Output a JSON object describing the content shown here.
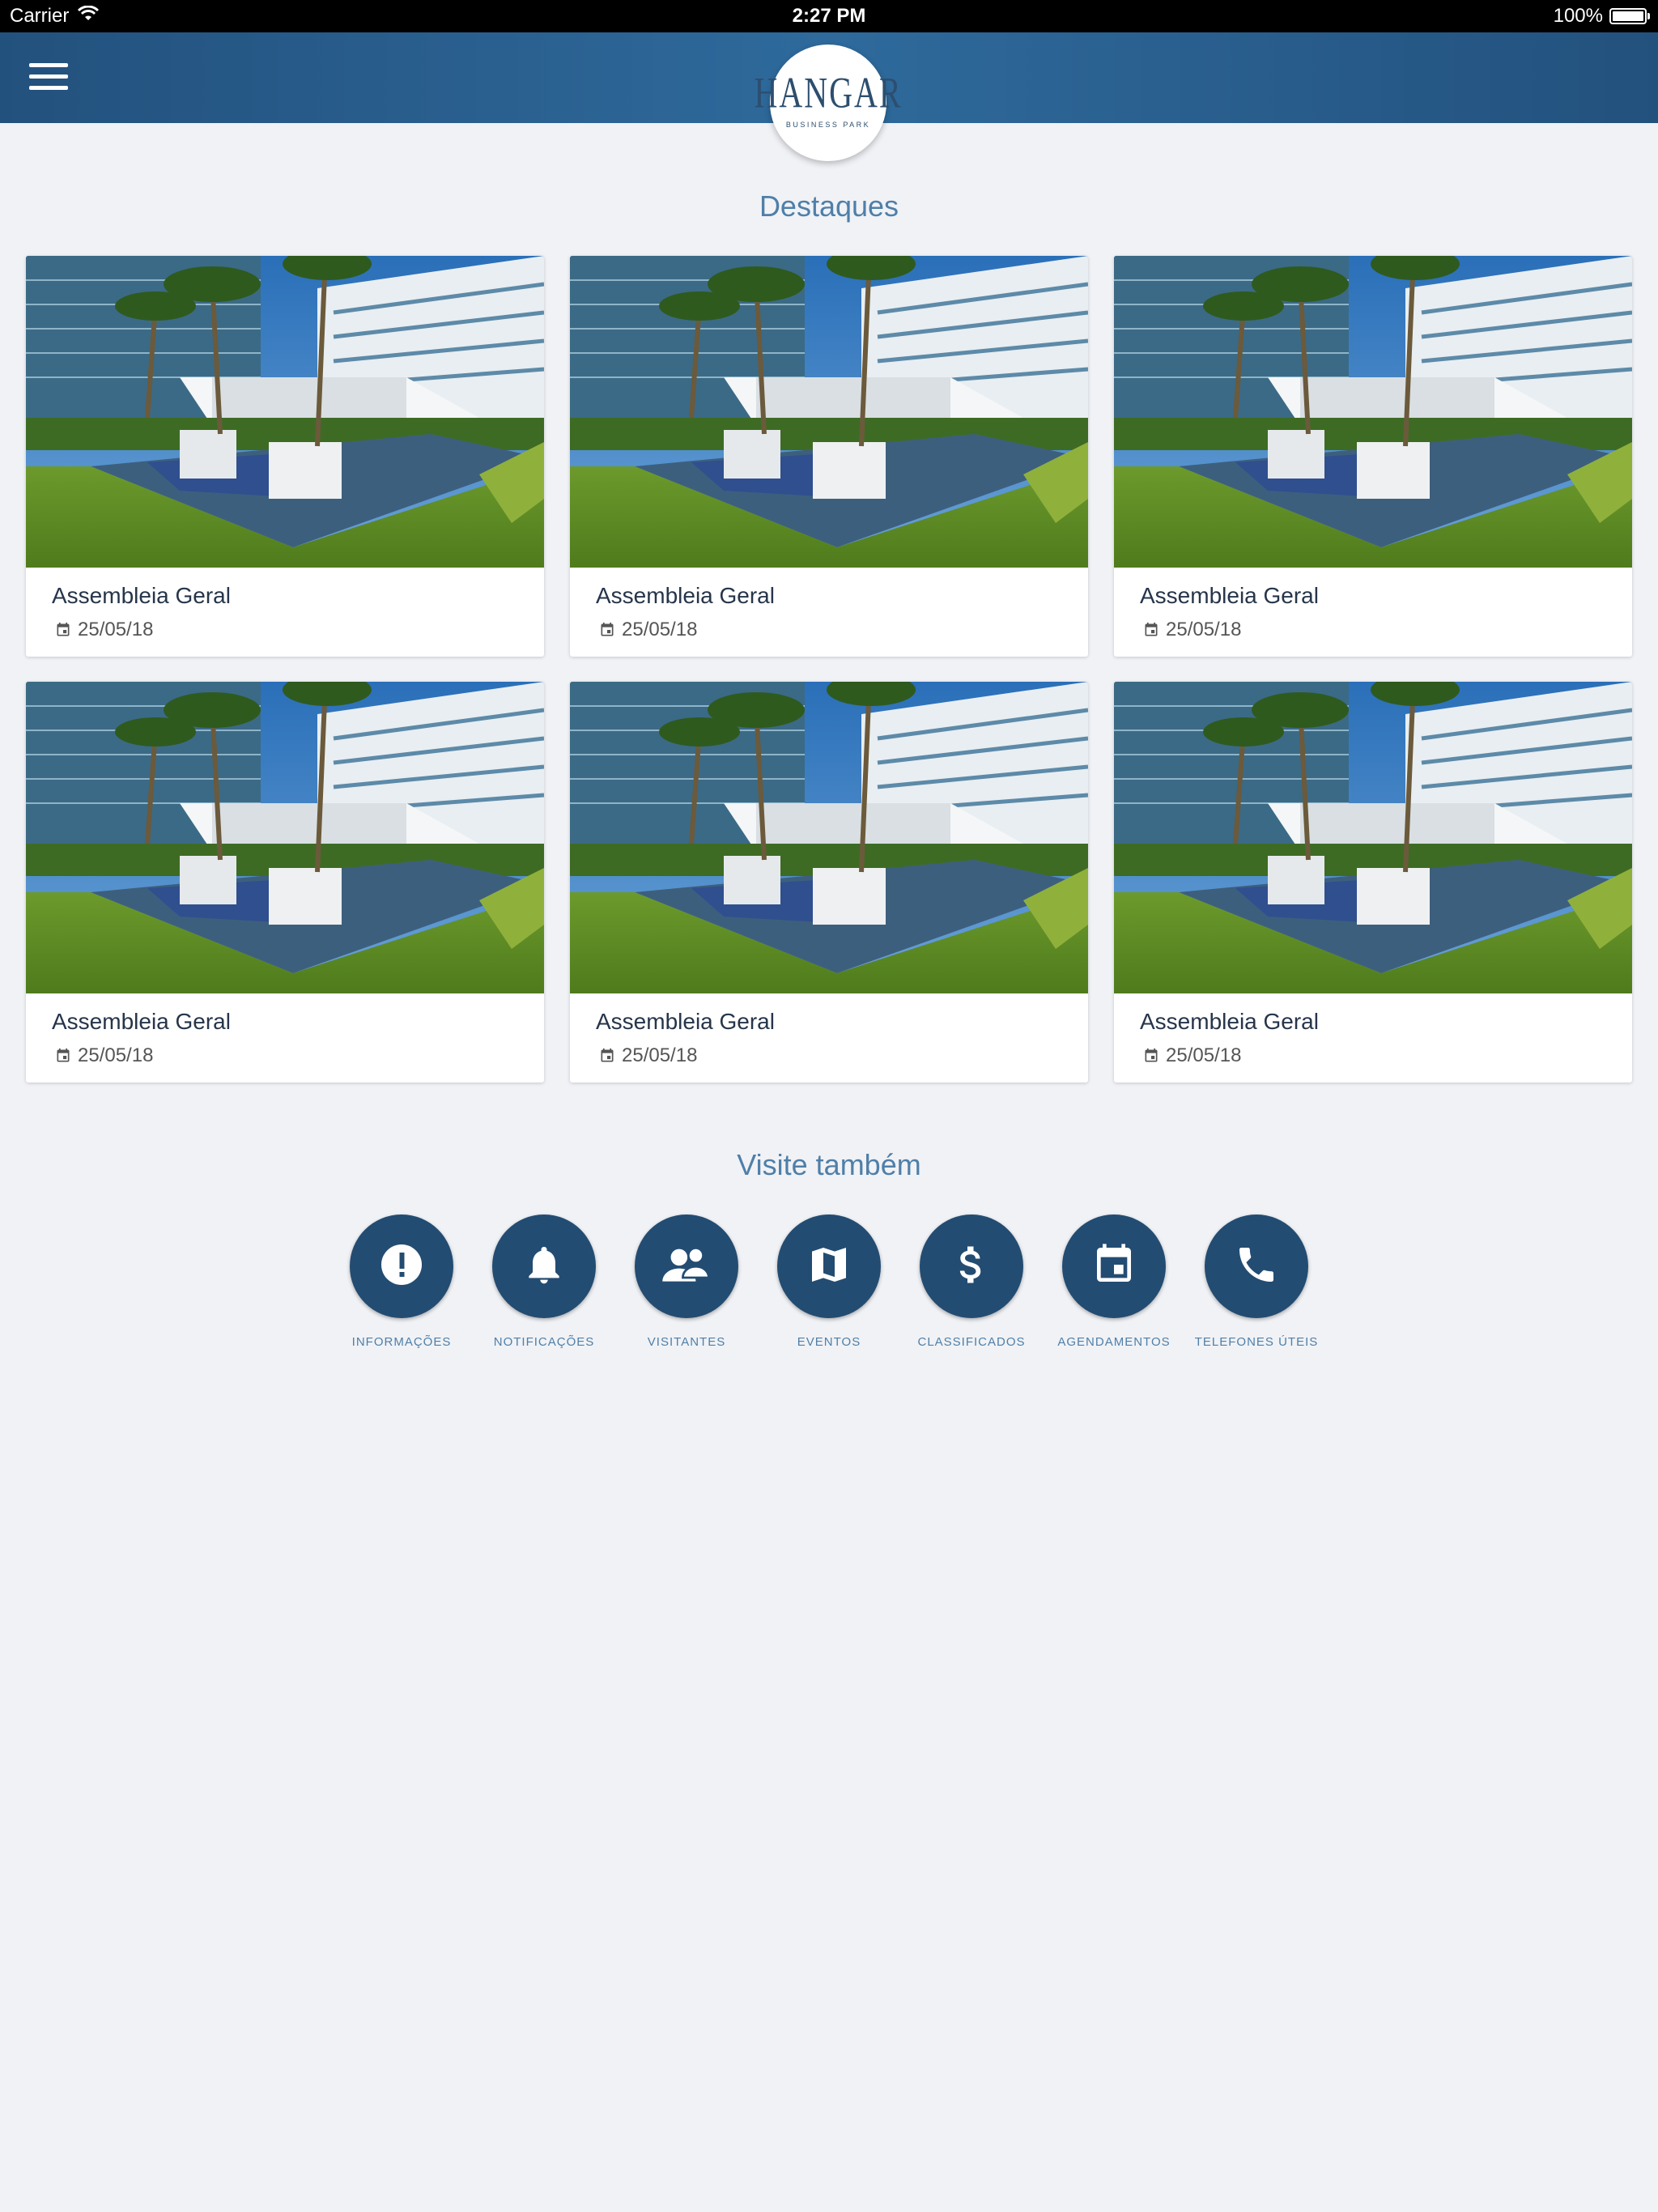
{
  "status_bar": {
    "carrier": "Carrier",
    "time": "2:27 PM",
    "battery": "100%"
  },
  "header": {
    "logo_text": "HANGAR",
    "logo_subtext": "BUSINESS PARK"
  },
  "highlights": {
    "title": "Destaques",
    "cards": [
      {
        "title": "Assembleia Geral",
        "date": "25/05/18"
      },
      {
        "title": "Assembleia Geral",
        "date": "25/05/18"
      },
      {
        "title": "Assembleia Geral",
        "date": "25/05/18"
      },
      {
        "title": "Assembleia Geral",
        "date": "25/05/18"
      },
      {
        "title": "Assembleia Geral",
        "date": "25/05/18"
      },
      {
        "title": "Assembleia Geral",
        "date": "25/05/18"
      }
    ]
  },
  "visit_also": {
    "title": "Visite também",
    "items": [
      {
        "label": "INFORMAÇÕES",
        "icon": "alert-icon"
      },
      {
        "label": "NOTIFICAÇÕES",
        "icon": "bell-icon"
      },
      {
        "label": "VISITANTES",
        "icon": "visitors-icon"
      },
      {
        "label": "EVENTOS",
        "icon": "map-icon"
      },
      {
        "label": "CLASSIFICADOS",
        "icon": "dollar-icon"
      },
      {
        "label": "AGENDAMENTOS",
        "icon": "calendar-icon"
      },
      {
        "label": "TELEFONES ÚTEIS",
        "icon": "phone-icon"
      }
    ]
  },
  "colors": {
    "header": "#2b5f8e",
    "accent": "#4f7fa8",
    "shortcut_circle": "#234c72",
    "background": "#f0f2f6"
  }
}
